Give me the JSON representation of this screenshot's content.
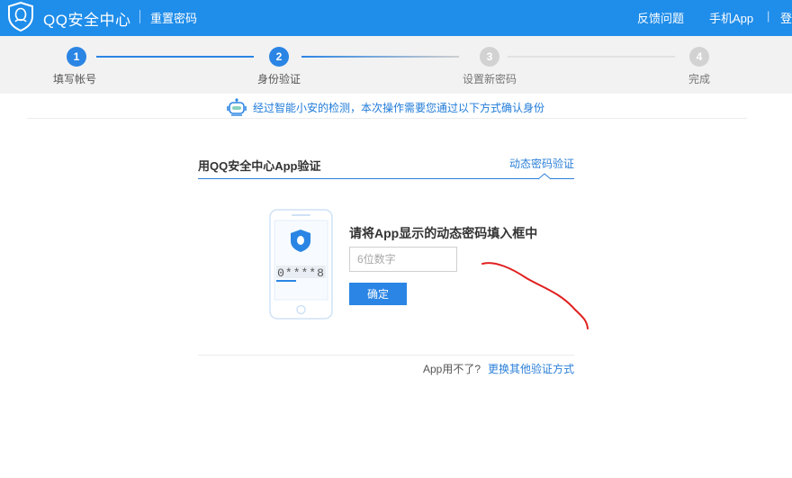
{
  "header": {
    "brand": "QQ安全中心",
    "page_name": "重置密码",
    "feedback_link": "反馈问题",
    "mobile_app_link": "手机App",
    "login_link": "登",
    "bg_color": "#1f8dea"
  },
  "steps": [
    {
      "number": "1",
      "label": "填写帐号",
      "state": "done"
    },
    {
      "number": "2",
      "label": "身份验证",
      "state": "active"
    },
    {
      "number": "3",
      "label": "设置新密码",
      "state": "pending"
    },
    {
      "number": "4",
      "label": "完成",
      "state": "pending"
    }
  ],
  "notice": {
    "text": "经过智能小安的检测，本次操作需要您通过以下方式确认身份",
    "icon": "robot-icon"
  },
  "verify_panel": {
    "title": "用QQ安全中心App验证",
    "switch_tab": "动态密码验证",
    "phone_code_display": "0****8",
    "instruction": "请将App显示的动态密码填入框中",
    "input_value": "",
    "input_placeholder": "6位数字",
    "confirm_button": "确定",
    "alt_prefix": "App用不了?",
    "alt_link": "更换其他验证方式"
  },
  "colors": {
    "accent": "#2b85e4",
    "step_done": "#2b85e4",
    "step_pending": "#cfcfcf",
    "link": "#2b7fd8",
    "annotation": "#e02020"
  }
}
